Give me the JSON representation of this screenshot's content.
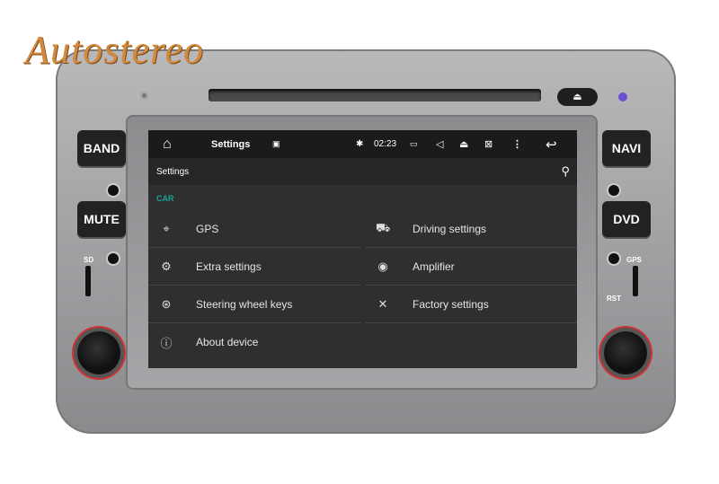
{
  "logo": "Autostereo",
  "hardware": {
    "band": "BAND",
    "mute": "MUTE",
    "navi": "NAVI",
    "dvd": "DVD",
    "sd": "SD",
    "gps": "GPS",
    "rst": "RST",
    "eject": "⏏"
  },
  "status_bar": {
    "title": "Settings",
    "time": "02:23"
  },
  "app_bar": {
    "title": "Settings"
  },
  "section": "CAR",
  "items": [
    {
      "label": "GPS",
      "icon": "gps-icon"
    },
    {
      "label": "Driving settings",
      "icon": "car-icon"
    },
    {
      "label": "Extra settings",
      "icon": "gears-icon"
    },
    {
      "label": "Amplifier",
      "icon": "speaker-icon"
    },
    {
      "label": "Steering wheel keys",
      "icon": "steering-wheel-icon"
    },
    {
      "label": "Factory settings",
      "icon": "tools-icon"
    },
    {
      "label": "About device",
      "icon": "info-icon"
    }
  ],
  "colors": {
    "accent": "#1ba39a",
    "screen_bg": "#2f2f30",
    "logo": "#d28a3e"
  }
}
